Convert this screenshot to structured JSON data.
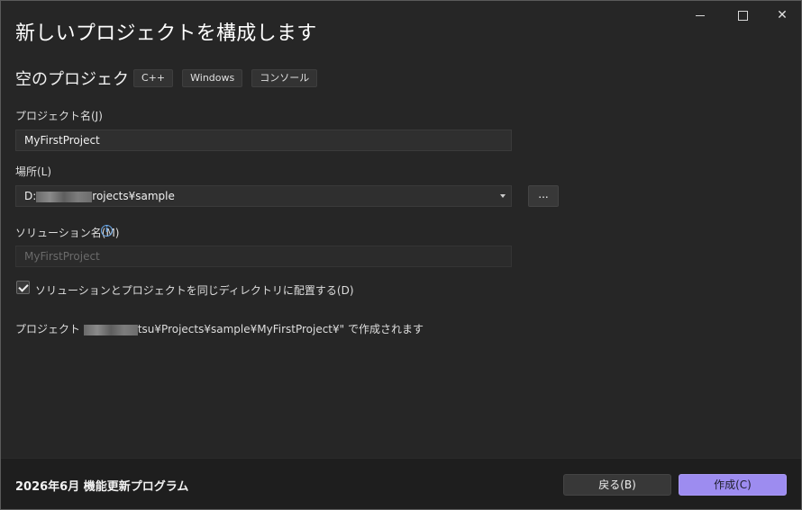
{
  "window": {
    "title": "新しいプロジェクトを構成します",
    "controls": {
      "minimize": "minimize-icon",
      "maximize": "maximize-icon",
      "close": "✕"
    }
  },
  "template": {
    "name": "空のプロジェクト",
    "tags": [
      "C++",
      "Windows",
      "コンソール"
    ]
  },
  "form": {
    "project_name_label": "プロジェクト名(J)",
    "project_name_value": "MyFirstProject",
    "location_label": "場所(L)",
    "location_prefix": "D:",
    "location_suffix": "rojects¥sample",
    "browse_label": "...",
    "solution_name_label": "ソリューション名(M)",
    "solution_name_placeholder": "MyFirstProject",
    "same_dir_label": "ソリューションとプロジェクトを同じディレクトリに配置する(D)",
    "same_dir_checked": true,
    "path_prefix": "プロジェクト",
    "path_suffix": "tsu¥Projects¥sample¥MyFirstProject¥\" で作成されます"
  },
  "footer": {
    "version_text": "2026年6月 機能更新プログラム",
    "back_button": "戻る(B)",
    "create_button": "作成(C)"
  },
  "colors": {
    "accent": "#9d8cf0",
    "background": "#262626",
    "info": "#6aa6e6"
  }
}
